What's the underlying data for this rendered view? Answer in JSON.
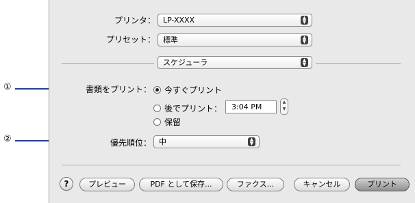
{
  "printer": {
    "label": "プリンタ：",
    "value": "LP-XXXX"
  },
  "preset": {
    "label": "プリセット：",
    "value": "標準"
  },
  "panel": {
    "value": "スケジューラ"
  },
  "print_document": {
    "label": "書類をプリント：",
    "options": [
      "今すぐプリント",
      "後でプリント：",
      "保留"
    ],
    "selected": "今すぐプリント",
    "time": "3:04 PM"
  },
  "priority": {
    "label": "優先順位：",
    "value": "中"
  },
  "buttons": {
    "help": "?",
    "preview": "プレビュー",
    "save_pdf": "PDF として保存...",
    "fax": "ファクス...",
    "cancel": "キャンセル",
    "print": "プリント"
  },
  "callouts": {
    "one": "①",
    "two": "②"
  },
  "colors": {
    "callout_line": "#1f3fa8",
    "dialog_bg": "#e9e9e9"
  }
}
